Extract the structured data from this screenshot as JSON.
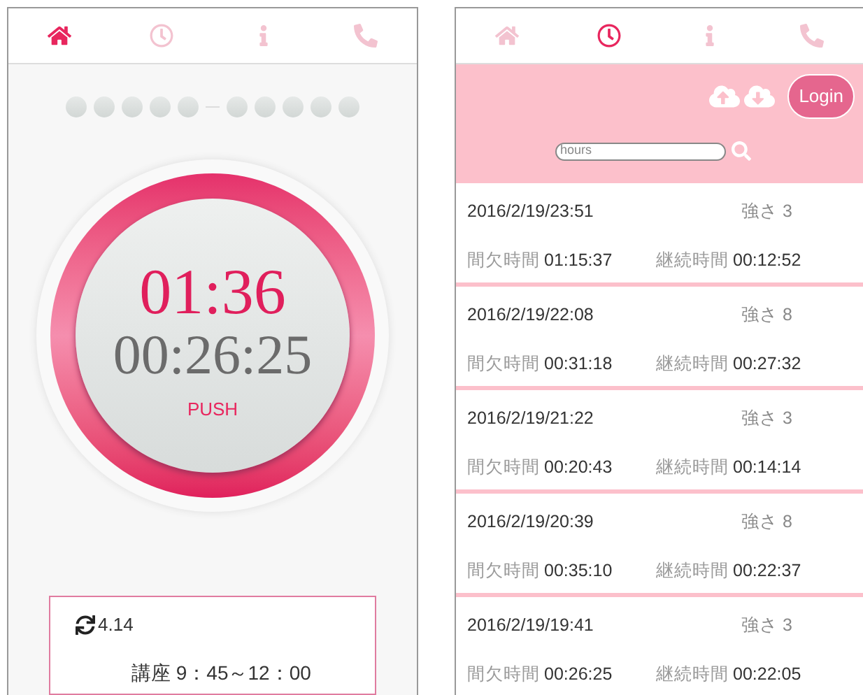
{
  "left": {
    "tabs": [
      {
        "kind": "home",
        "selected": true
      },
      {
        "kind": "clock",
        "selected": false
      },
      {
        "kind": "info",
        "selected": false
      },
      {
        "kind": "phone",
        "selected": false
      }
    ],
    "timer": {
      "main": "01:36",
      "elapsed": "00:26:25",
      "button": "PUSH"
    },
    "card": {
      "version": "4.14",
      "schedule": "講座 9：45～12：00"
    }
  },
  "right": {
    "tabs": [
      {
        "kind": "home",
        "selected": false
      },
      {
        "kind": "clock",
        "selected": true
      },
      {
        "kind": "info",
        "selected": false
      },
      {
        "kind": "phone",
        "selected": false
      }
    ],
    "login": "Login",
    "search": {
      "placeholder": "hours"
    },
    "entries": [
      {
        "date": "2016/2/19/23:51",
        "strength": "強さ 3",
        "interval_label": "間欠時間",
        "interval": "01:15:37",
        "duration_label": "継続時間",
        "duration": "00:12:52"
      },
      {
        "date": "2016/2/19/22:08",
        "strength": "強さ 8",
        "interval_label": "間欠時間",
        "interval": "00:31:18",
        "duration_label": "継続時間",
        "duration": "00:27:32"
      },
      {
        "date": "2016/2/19/21:22",
        "strength": "強さ 3",
        "interval_label": "間欠時間",
        "interval": "00:20:43",
        "duration_label": "継続時間",
        "duration": "00:14:14"
      },
      {
        "date": "2016/2/19/20:39",
        "strength": "強さ 8",
        "interval_label": "間欠時間",
        "interval": "00:35:10",
        "duration_label": "継続時間",
        "duration": "00:22:37"
      },
      {
        "date": "2016/2/19/19:41",
        "strength": "強さ 3",
        "interval_label": "間欠時間",
        "interval": "00:26:25",
        "duration_label": "継続時間",
        "duration": "00:22:05"
      }
    ]
  }
}
